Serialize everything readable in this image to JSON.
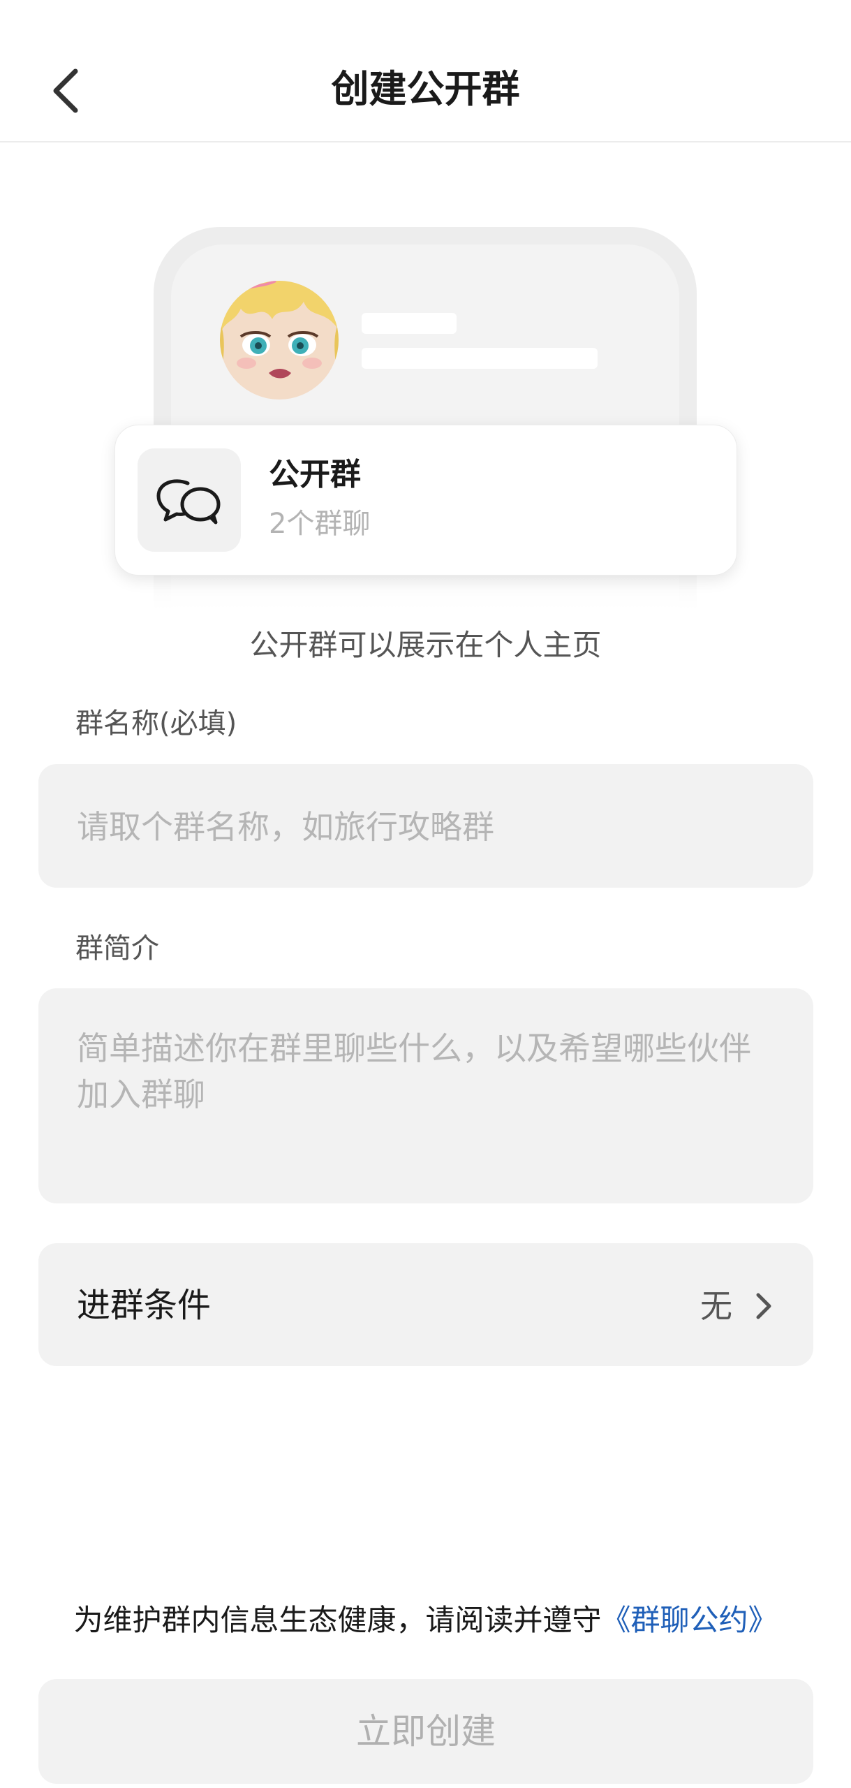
{
  "header": {
    "title": "创建公开群",
    "back_icon": "chevron-left-icon"
  },
  "preview": {
    "group_icon": "chat-bubbles-icon",
    "group_title": "公开群",
    "group_subtitle": "2个群聊",
    "intro_text": "公开群可以展示在个人主页"
  },
  "form": {
    "name_label": "群名称(必填)",
    "name_placeholder": "请取个群名称，如旅行攻略群",
    "intro_label": "群简介",
    "intro_placeholder": "简单描述你在群里聊些什么，以及希望哪些伙伴加入群聊",
    "condition_label": "进群条件",
    "condition_value": "无"
  },
  "footer": {
    "notice_text": "为维护群内信息生态健康，请阅读并遵守",
    "notice_link": "《群聊公约》",
    "create_label": "立即创建"
  },
  "colors": {
    "link": "#1f5fb8",
    "field_background": "#f2f2f2",
    "disabled_text": "#b0b0b0"
  }
}
